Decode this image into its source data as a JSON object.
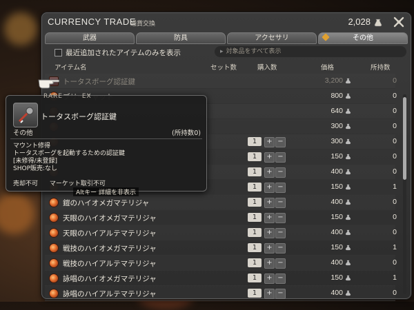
{
  "window": {
    "title_en": "CURRENCY TRADE",
    "title_jp": "通貨交換",
    "gil_amount": "2,028"
  },
  "tabs": [
    {
      "label": "武器"
    },
    {
      "label": "防具"
    },
    {
      "label": "アクセサリ"
    },
    {
      "label": "その他"
    }
  ],
  "filter": {
    "checkbox_label": "最近追加されたアイテムのみを表示",
    "show_all_label": "対象品をすべて表示"
  },
  "headers": {
    "item_name": "アイテム名",
    "set_count": "セット数",
    "purchase_count": "購入数",
    "price": "価格",
    "owned": "所持数"
  },
  "rows": [
    {
      "name": "トータスボーグ認証鍵",
      "price": "3,200",
      "owned": "0",
      "qty": "",
      "dim": true
    },
    {
      "name": "ブリーキャット",
      "price": "800",
      "owned": "0",
      "qty": ""
    },
    {
      "name": "",
      "price": "640",
      "owned": "0",
      "qty": ""
    },
    {
      "name": "",
      "price": "300",
      "owned": "0",
      "qty": ""
    },
    {
      "name": "",
      "price": "300",
      "owned": "0",
      "qty": "1"
    },
    {
      "name": "",
      "price": "150",
      "owned": "0",
      "qty": "1"
    },
    {
      "name": "",
      "price": "400",
      "owned": "0",
      "qty": "1"
    },
    {
      "name": "",
      "price": "150",
      "owned": "1",
      "qty": "1"
    },
    {
      "name": "鎧のハイオメガマテリジャ",
      "price": "400",
      "owned": "0",
      "qty": "1"
    },
    {
      "name": "天眼のハイオメガマテリジャ",
      "price": "150",
      "owned": "0",
      "qty": "1"
    },
    {
      "name": "天眼のハイアルテマテリジャ",
      "price": "400",
      "owned": "0",
      "qty": "1"
    },
    {
      "name": "戦技のハイオメガマテリジャ",
      "price": "150",
      "owned": "1",
      "qty": "1"
    },
    {
      "name": "戦技のハイアルテマテリジャ",
      "price": "400",
      "owned": "0",
      "qty": "1"
    },
    {
      "name": "詠唱のハイオメガマテリジャ",
      "price": "150",
      "owned": "1",
      "qty": "1"
    },
    {
      "name": "詠唱のハイアルテマテリジャ",
      "price": "400",
      "owned": "0",
      "qty": "1"
    }
  ],
  "tooltip": {
    "tag_rare": "RARE",
    "tag_ex": "EX",
    "item_name": "トータスボーグ認証鍵",
    "category": "その他",
    "owned": "(所持数0)",
    "desc_line1": "マウント修得",
    "desc_line2": "トータスボーグを起動するための認証鍵",
    "desc_line3": "[未修得/未登録]",
    "desc_line4": "SHOP販売:なし",
    "flag_unsellable": "売却不可",
    "flag_untradeable": "マーケット取引不可",
    "hint": "Altキー 詳細を非表示"
  },
  "icons": {
    "gil": "gil-bag-icon",
    "settings": "crossed-tools-icon",
    "pointer": "pointing-hand-icon"
  }
}
